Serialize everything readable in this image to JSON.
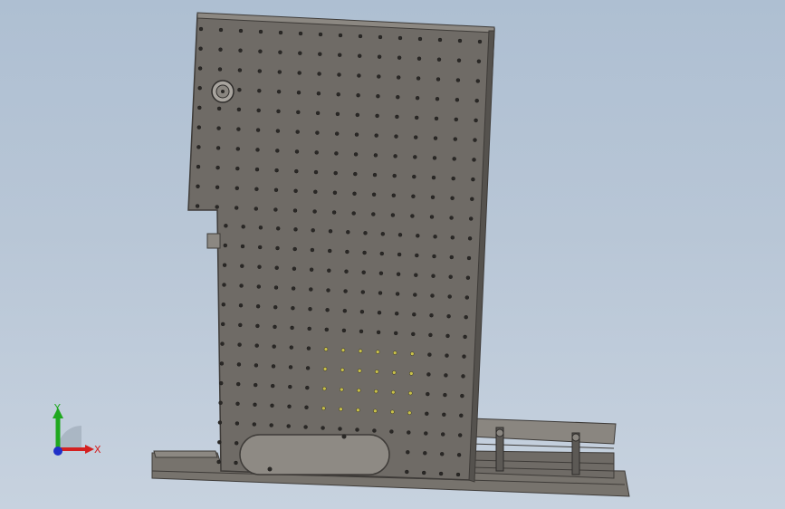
{
  "viewport": {
    "background_top": "#aebfd2",
    "background_bottom": "#c7d2df"
  },
  "model": {
    "panel_color": "#6f6b66",
    "panel_edge_color": "#3e3b38",
    "hole_color": "#2a2826",
    "highlight_hole_color": "#c8c04a",
    "base_color": "#77736d",
    "rail_color": "#8a8680"
  },
  "triad": {
    "x_label": "X",
    "y_label": "Y",
    "x_color": "#d42020",
    "y_color": "#1fa81f",
    "z_color": "#2030c8"
  }
}
